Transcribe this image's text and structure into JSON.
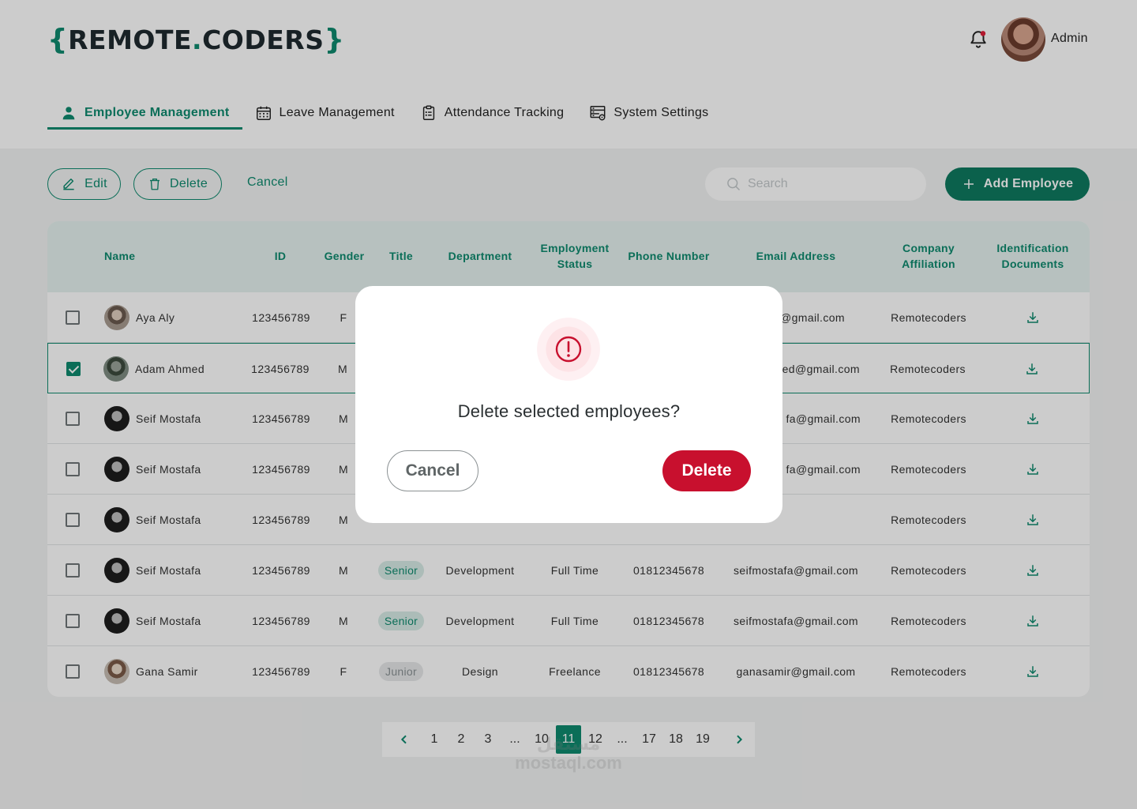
{
  "brand": {
    "open_brace": "{",
    "name_part1": "REMOTE",
    "dot": ".",
    "name_part2": "CODERS",
    "close_brace": "}"
  },
  "header": {
    "user_label": "Admin"
  },
  "tabs": [
    {
      "label": "Employee Management",
      "icon": "person-icon",
      "active": true
    },
    {
      "label": "Leave Management",
      "icon": "calendar-icon",
      "active": false
    },
    {
      "label": "Attendance Tracking",
      "icon": "clipboard-icon",
      "active": false
    },
    {
      "label": "System Settings",
      "icon": "settings-panel-icon",
      "active": false
    }
  ],
  "toolbar": {
    "edit_label": "Edit",
    "delete_label": "Delete",
    "cancel_label": "Cancel",
    "search_placeholder": "Search",
    "add_label": "Add Employee"
  },
  "table": {
    "columns": {
      "name": "Name",
      "id": "ID",
      "gender": "Gender",
      "title": "Title",
      "department": "Department",
      "employment_status": "Employment Status",
      "phone": "Phone Number",
      "email": "Email Address",
      "company": "Company Affiliation",
      "documents": "Identification Documents"
    },
    "rows": [
      {
        "name": "Aya Aly",
        "id": "123456789",
        "gender": "F",
        "title": "",
        "department": "",
        "status": "",
        "phone": "",
        "email": "@gmail.com",
        "company": "Remotecoders",
        "checked": false
      },
      {
        "name": "Adam Ahmed",
        "id": "123456789",
        "gender": "M",
        "title": "",
        "department": "",
        "status": "",
        "phone": "",
        "email": "ed@gmail.com",
        "company": "Remotecoders",
        "checked": true
      },
      {
        "name": "Seif Mostafa",
        "id": "123456789",
        "gender": "M",
        "title": "",
        "department": "",
        "status": "",
        "phone": "",
        "email": "fa@gmail.com",
        "company": "Remotecoders",
        "checked": false
      },
      {
        "name": "Seif Mostafa",
        "id": "123456789",
        "gender": "M",
        "title": "",
        "department": "",
        "status": "",
        "phone": "",
        "email": "fa@gmail.com",
        "company": "Remotecoders",
        "checked": false
      },
      {
        "name": "Seif Mostafa",
        "id": "123456789",
        "gender": "M",
        "title": "",
        "department": "",
        "status": "",
        "phone": "",
        "email": "",
        "company": "Remotecoders",
        "checked": false
      },
      {
        "name": "Seif Mostafa",
        "id": "123456789",
        "gender": "M",
        "title": "Senior",
        "department": "Development",
        "status": "Full Time",
        "phone": "01812345678",
        "email": "seifmostafa@gmail.com",
        "company": "Remotecoders",
        "checked": false
      },
      {
        "name": "Seif Mostafa",
        "id": "123456789",
        "gender": "M",
        "title": "Senior",
        "department": "Development",
        "status": "Full Time",
        "phone": "01812345678",
        "email": "seifmostafa@gmail.com",
        "company": "Remotecoders",
        "checked": false
      },
      {
        "name": "Gana Samir",
        "id": "123456789",
        "gender": "F",
        "title": "Junior",
        "department": "Design",
        "status": "Freelance",
        "phone": "01812345678",
        "email": "ganasamir@gmail.com",
        "company": "Remotecoders",
        "checked": false
      }
    ]
  },
  "pagination": {
    "pages": [
      "1",
      "2",
      "3",
      "...",
      "10",
      "11",
      "12",
      "...",
      "17",
      "18",
      "19"
    ],
    "current": "11"
  },
  "watermark": {
    "line1": "مستقل",
    "line2": "mostaql.com"
  },
  "modal": {
    "message": "Delete selected employees?",
    "cancel_label": "Cancel",
    "delete_label": "Delete"
  },
  "colors": {
    "accent": "#0e8a6e",
    "danger": "#c8102e",
    "add_button": "#0e7a60",
    "header_bg": "#e5f2ef"
  }
}
